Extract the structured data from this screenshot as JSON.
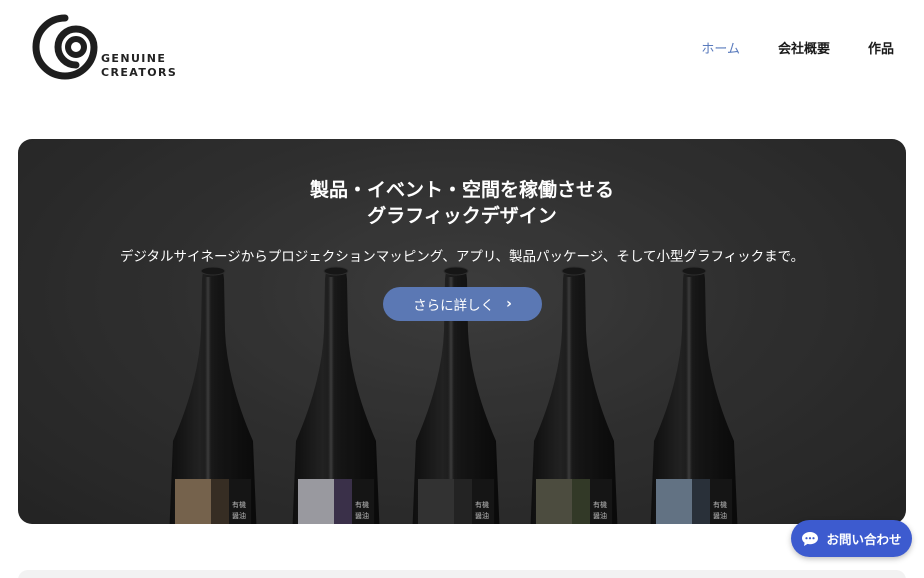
{
  "header": {
    "logo_line1": "GENUINE",
    "logo_line2": "CREATORS",
    "nav": [
      {
        "label": "ホーム",
        "active": true
      },
      {
        "label": "会社概要",
        "active": false
      },
      {
        "label": "作品",
        "active": false
      }
    ]
  },
  "hero": {
    "title_line1": "製品・イベント・空間を稼働させる",
    "title_line2": "グラフィックデザイン",
    "subtitle": "デジタルサイネージからプロジェクションマッピング、アプリ、製品パッケージ、そして小型グラフィックまで。",
    "cta_label": "さらに詳しく",
    "bottle_label": "有機\n醤油"
  },
  "chat": {
    "label": "お問い合わせ"
  },
  "colors": {
    "accent": "#5a7bbd",
    "cta": "#5b78b4",
    "chat": "#3d5bcf"
  }
}
